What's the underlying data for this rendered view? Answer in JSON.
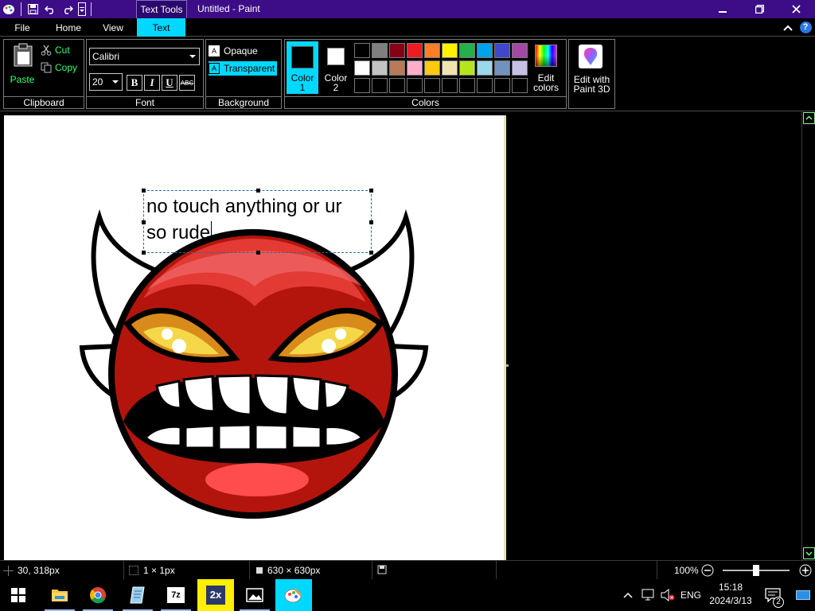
{
  "titlebar": {
    "context_tab": "Text Tools",
    "window_title": "Untitled - Paint"
  },
  "tabs": [
    {
      "label": "File"
    },
    {
      "label": "Home"
    },
    {
      "label": "View"
    },
    {
      "label": "Text",
      "active": true
    }
  ],
  "ribbon": {
    "clipboard": {
      "paste": "Paste",
      "cut": "Cut",
      "copy": "Copy",
      "label": "Clipboard"
    },
    "font": {
      "family": "Calibri",
      "size": "20",
      "bold": "B",
      "italic": "I",
      "underline": "U",
      "strike": "ABC",
      "label": "Font"
    },
    "background": {
      "opaque": "Opaque",
      "transparent": "Transparent",
      "label": "Background"
    },
    "colors": {
      "color1_line1": "Color",
      "color1_line2": "1",
      "color2_line1": "Color",
      "color2_line2": "2",
      "edit_line1": "Edit",
      "edit_line2": "colors",
      "label": "Colors",
      "color1": "#000000",
      "color2": "#ffffff",
      "palette_row1": [
        "#000000",
        "#7f7f7f",
        "#880015",
        "#ed1c24",
        "#ff7f27",
        "#fff200",
        "#22b14c",
        "#00a2e8",
        "#3f48cc",
        "#a349a4"
      ],
      "palette_row2": [
        "#ffffff",
        "#c3c3c3",
        "#b97a57",
        "#ffaec9",
        "#ffc90e",
        "#efe4b0",
        "#b5e61d",
        "#99d9ea",
        "#7092be",
        "#c8bfe7"
      ]
    },
    "paint3d": {
      "line1": "Edit with",
      "line2": "Paint 3D"
    }
  },
  "canvas": {
    "text": "no touch anything or ur\nso rude"
  },
  "status": {
    "cursor_pos": "30, 318px",
    "selection_size": "1 × 1px",
    "image_size": "630 × 630px",
    "zoom": "100%",
    "zoom_slider_fraction": 0.5
  },
  "taskbar": {
    "apps": [
      "file-explorer-icon",
      "chrome-icon",
      "notepad-icon",
      "7zip-icon",
      "app-2x-icon",
      "photos-icon",
      "paint-icon"
    ],
    "lang": "ENG",
    "time": "15:18",
    "date": "2024/3/13",
    "notifications": "2"
  }
}
